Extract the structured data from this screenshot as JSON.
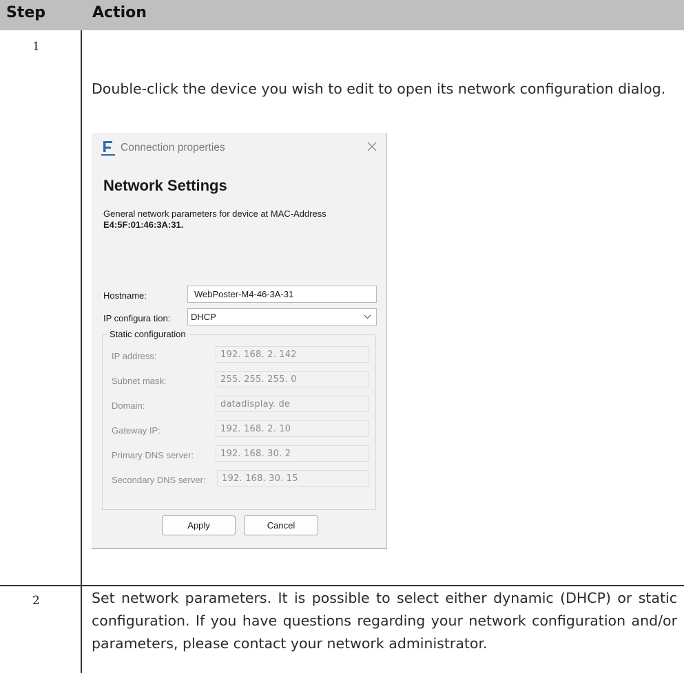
{
  "table": {
    "header": {
      "step": "Step",
      "action": "Action"
    },
    "rows": [
      {
        "step": "1",
        "text": "Double-click the device you wish to edit to open its network configuration dialog."
      },
      {
        "step": "2",
        "text": "Set network parameters. It is possible to select either dynamic (DHCP) or static configuration. If you have questions regarding your network configuration and/or parameters, please contact your network administrator."
      }
    ]
  },
  "dialog": {
    "window_title": "Connection properties",
    "heading": "Network Settings",
    "description": "General network parameters for device at MAC-Address",
    "mac_address": "E4:5F:01:46:3A:31",
    "mac_suffix": ".",
    "hostname_label": "Hostname:",
    "hostname_value": "WebPoster-M4-46-3A-31",
    "ip_config_label": "IP configura tion:",
    "ip_config_value": "DHCP",
    "static_group_title": "Static configuration",
    "static_fields": [
      {
        "label": "IP address:",
        "value": "192. 168. 2. 142"
      },
      {
        "label": "Subnet mask:",
        "value": "255. 255. 255. 0"
      },
      {
        "label": "Domain:",
        "value": "datadisplay. de"
      },
      {
        "label": "Gateway IP:",
        "value": "192. 168. 2. 10"
      },
      {
        "label": "Primary DNS server:",
        "value": "192. 168. 30. 2"
      },
      {
        "label": "Secondary DNS server:",
        "value": "192. 168. 30. 15"
      }
    ],
    "apply_label": "Apply",
    "cancel_label": "Cancel"
  },
  "colors": {
    "header_bg": "#bfbfbf",
    "logo_blue": "#2a6db3"
  },
  "icons": [
    "app-logo-icon",
    "close-icon",
    "chevron-down-icon"
  ]
}
